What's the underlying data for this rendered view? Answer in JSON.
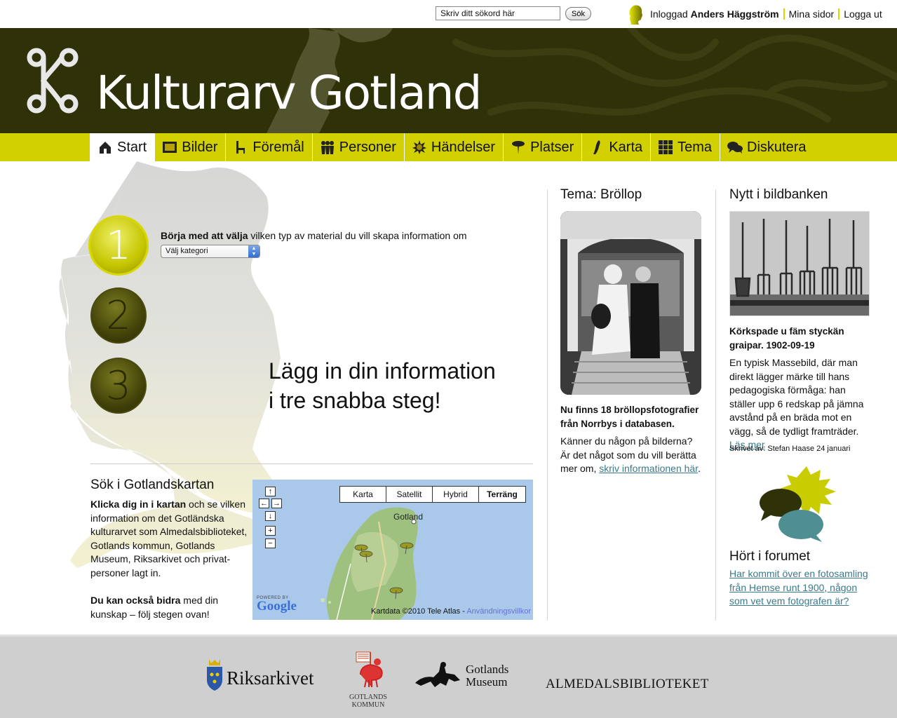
{
  "search": {
    "placeholder": "Skriv ditt sökord här",
    "value": "Skriv ditt sökord här",
    "button_label": "Sök"
  },
  "user": {
    "prefix": "Inloggad",
    "name": "Anders Häggström",
    "my_pages": "Mina sidor",
    "logout": "Logga ut"
  },
  "site": {
    "title": "Kulturarv Gotland"
  },
  "nav": {
    "items": [
      {
        "label": "Start",
        "icon": "house-icon",
        "active": true
      },
      {
        "label": "Bilder",
        "icon": "picture-frame-icon"
      },
      {
        "label": "Föremål",
        "icon": "chair-icon"
      },
      {
        "label": "Personer",
        "icon": "people-icon"
      },
      {
        "label": "Händelser",
        "icon": "burst-icon"
      },
      {
        "label": "Platser",
        "icon": "pin-icon"
      },
      {
        "label": "Karta",
        "icon": "island-map-icon"
      },
      {
        "label": "Tema",
        "icon": "grid-icon"
      },
      {
        "label": "Diskutera",
        "icon": "speech-bubbles-icon"
      }
    ]
  },
  "steps": {
    "numbers": [
      "1",
      "2",
      "3"
    ],
    "step1_bold": "Börja med att välja",
    "step1_rest": " vilken typ av material du vill skapa information om",
    "select_value": "Välj kategori",
    "headline_line1": "Lägg in din information",
    "headline_line2": "i tre snabba steg!"
  },
  "map_section": {
    "title": "Sök i Gotlandskartan",
    "desc_bold": "Klicka dig in i kartan",
    "desc_rest": " och se vilken information om det Gotländska kulturarvet som Almedalsbiblioteket, Gotlands kommun, Gotlands Museum, Riksarkivet och privat-personer lagt in.",
    "contrib_bold": "Du kan också bidra",
    "contrib_rest": " med din kunskap – följ stegen ovan!",
    "map_types": [
      "Karta",
      "Satellit",
      "Hybrid",
      "Terräng"
    ],
    "selected_type": "Terräng",
    "place_label": "Gotland",
    "credit": "Kartdata ©2010 Tele Atlas - ",
    "terms": "Användningsvillkor",
    "powered_by": "POWERED BY",
    "google": "Google"
  },
  "tema": {
    "title": "Tema: Bröllop",
    "bold": "Nu finns 18 bröllopsfotografier från Norrbys i databasen.",
    "text": "Känner du någon på bilderna? Är det något som du vill berätta mer om, ",
    "link": "skriv informationen här",
    "after": "."
  },
  "bildbanken": {
    "title": "Nytt i bildbanken",
    "bold": "Körkspade u fäm styckän graipar. 1902-09-19",
    "text": "En typisk Massebild, där man direkt lägger märke till hans pedagogiska förmåga: han ställer upp 6 redskap på jämna avstånd på en bräda mot en vägg, så de tydligt framträder. ",
    "link": "Läs mer",
    "author": "Skrivet av: Stefan Haase 24 januari"
  },
  "forum": {
    "title": "Hört i forumet",
    "link": "Har kommit över en fotosamling från Hemse runt 1900, någon som vet vem fotografen är?"
  },
  "partners": {
    "riksarkivet": "Riksarkivet",
    "kommun_1": "GOTLANDS",
    "kommun_2": "KOMMUN",
    "museum_1": "Gotlands",
    "museum_2": "Museum",
    "almedal": "ALMEDALSBIBLIOTEKET"
  },
  "colors": {
    "header": "#2f3108",
    "nav": "#d3d000",
    "accent": "#c5c500",
    "link": "#3a7a8a",
    "footer": "#cfcfcf"
  }
}
